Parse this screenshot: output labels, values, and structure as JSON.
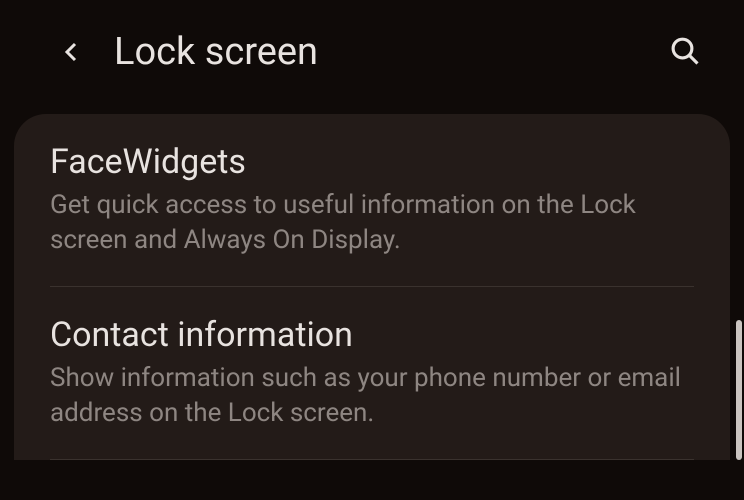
{
  "header": {
    "title": "Lock screen"
  },
  "items": [
    {
      "title": "FaceWidgets",
      "description": "Get quick access to useful information on the Lock screen and Always On Display."
    },
    {
      "title": "Contact information",
      "description": "Show information such as your phone number or email address on the Lock screen."
    }
  ]
}
